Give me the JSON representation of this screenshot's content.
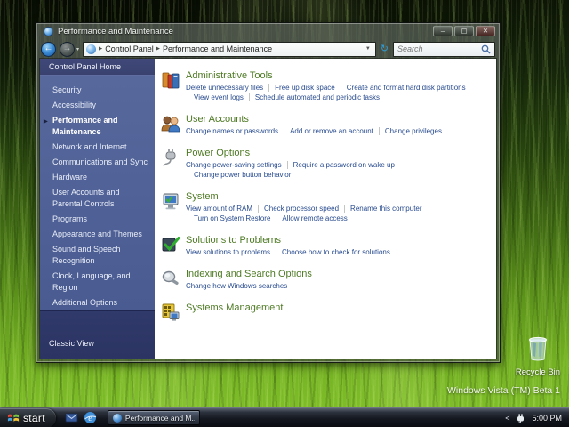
{
  "window": {
    "title": "Performance and Maintenance",
    "controls": {
      "minimize": "–",
      "maximize": "▢",
      "close": "✕"
    }
  },
  "address_bar": {
    "crumb_root": "Control Panel",
    "crumb_current": "Performance and Maintenance",
    "crumb_sep": "▶",
    "dropdown_glyph": "▼",
    "refresh_glyph": "↻",
    "search_placeholder": "Search"
  },
  "sidebar": {
    "home_label": "Control Panel Home",
    "selected_marker": "▶",
    "items": [
      "Security",
      "Accessibility",
      "Performance and Maintenance",
      "Network and Internet",
      "Communications and Sync",
      "Hardware",
      "User Accounts and Parental Controls",
      "Programs",
      "Appearance and Themes",
      "Sound and Speech Recognition",
      "Clock, Language, and Region",
      "Additional Options"
    ],
    "classic_view_label": "Classic View"
  },
  "sections": [
    {
      "title": "Administrative Tools",
      "icon": "admin-tools-icon",
      "rows": [
        [
          "Delete unnecessary files",
          "Free up disk space",
          "Create and format hard disk partitions"
        ],
        [
          "View event logs",
          "Schedule automated and periodic tasks"
        ]
      ]
    },
    {
      "title": "User Accounts",
      "icon": "user-accounts-icon",
      "rows": [
        [
          "Change names or passwords",
          "Add or remove an account",
          "Change privileges"
        ]
      ]
    },
    {
      "title": "Power Options",
      "icon": "power-options-icon",
      "rows": [
        [
          "Change power-saving settings",
          "Require a password on wake up"
        ],
        [
          "Change power button behavior"
        ]
      ]
    },
    {
      "title": "System",
      "icon": "system-icon",
      "rows": [
        [
          "View amount of RAM",
          "Check processor speed",
          "Rename this computer"
        ],
        [
          "Turn on System Restore",
          "Allow remote access"
        ]
      ]
    },
    {
      "title": "Solutions to Problems",
      "icon": "solutions-icon",
      "rows": [
        [
          "View solutions to problems",
          "Choose how to check for solutions"
        ]
      ]
    },
    {
      "title": "Indexing and Search Options",
      "icon": "indexing-search-icon",
      "rows": [
        [
          "Change how Windows searches"
        ]
      ]
    },
    {
      "title": "Systems Management",
      "icon": "systems-management-icon",
      "rows": []
    }
  ],
  "desktop": {
    "recycle_bin_label": "Recycle Bin",
    "watermark": "Windows Vista (TM) Beta 1"
  },
  "taskbar": {
    "start_label": "start",
    "task_button_label": "Performance and M...",
    "tray_chevron": "<",
    "clock": "5:00 PM"
  },
  "colors": {
    "heading_green": "#4e7a24",
    "link_blue": "#284b8f",
    "sidebar_blue": "#51629a",
    "taskbar_dark": "#14171c"
  }
}
